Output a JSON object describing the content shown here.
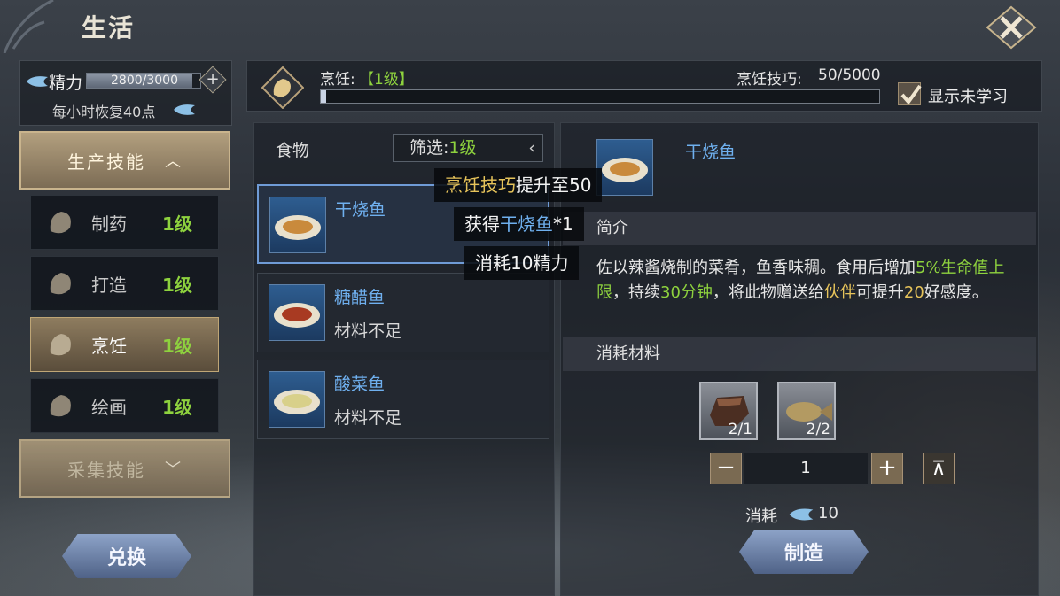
{
  "header": {
    "title": "生活"
  },
  "energy": {
    "label": "精力",
    "value": "2800/3000",
    "fill": 0.933,
    "regen": "每小时恢复40点"
  },
  "categories": {
    "production": "生产技能",
    "gathering": "采集技能"
  },
  "skills": [
    {
      "name": "制药",
      "level": "1级"
    },
    {
      "name": "打造",
      "level": "1级"
    },
    {
      "name": "烹饪",
      "level": "1级"
    },
    {
      "name": "绘画",
      "level": "1级"
    }
  ],
  "exchange_label": "兑换",
  "skillbar": {
    "name": "烹饪:",
    "level": "【1级】",
    "skill_label": "烹饪技巧:",
    "skill_value": "50/5000",
    "progress": 0.01,
    "show_unlearned": "显示未学习"
  },
  "list": {
    "header": "食物",
    "filter": "筛选:",
    "filter_value": "1级",
    "items": [
      {
        "name": "干烧鱼",
        "status": ""
      },
      {
        "name": "糖醋鱼",
        "status": "材料不足"
      },
      {
        "name": "酸菜鱼",
        "status": "材料不足"
      }
    ]
  },
  "tooltip": {
    "line1_hl": "烹饪技巧",
    "line1_rest": "提升至50",
    "line2_pre": "获得",
    "line2_item": "干烧鱼",
    "line2_qty": "*1",
    "line3": "消耗10精力"
  },
  "detail": {
    "name": "干烧鱼",
    "intro_label": "简介",
    "desc_1": "佐以辣酱烧制的菜肴，鱼香味稠。食用后增加",
    "desc_hp": "5%生命值上限",
    "desc_2": "，持续",
    "desc_time": "30分钟",
    "desc_3": "，将此物赠送给",
    "desc_partner": "伙伴",
    "desc_4": "可提升",
    "desc_num": "20",
    "desc_5": "好感度。",
    "materials_label": "消耗材料",
    "materials": [
      {
        "count": "2/1"
      },
      {
        "count": "2/2"
      }
    ],
    "quantity": "1",
    "cost_label": "消耗",
    "cost_value": "10",
    "craft_label": "制造"
  }
}
